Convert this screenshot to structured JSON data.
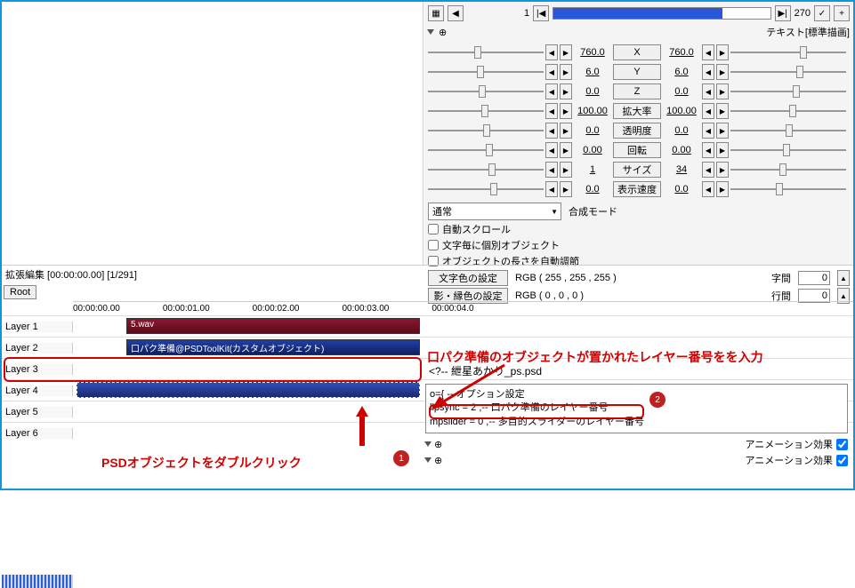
{
  "toolbar": {
    "frame": "1",
    "total": "270",
    "title": "テキスト[標準描画]"
  },
  "params": [
    {
      "name": "X",
      "v1": "760.0",
      "v2": "760.0"
    },
    {
      "name": "Y",
      "v1": "6.0",
      "v2": "6.0"
    },
    {
      "name": "Z",
      "v1": "0.0",
      "v2": "0.0"
    },
    {
      "name": "拡大率",
      "v1": "100.00",
      "v2": "100.00"
    },
    {
      "name": "透明度",
      "v1": "0.0",
      "v2": "0.0"
    },
    {
      "name": "回転",
      "v1": "0.00",
      "v2": "0.00"
    },
    {
      "name": "サイズ",
      "v1": "1",
      "v2": "34"
    },
    {
      "name": "表示速度",
      "v1": "0.0",
      "v2": "0.0"
    }
  ],
  "blend": {
    "label": "合成モード",
    "value": "通常"
  },
  "checks": {
    "autoscroll": "自動スクロール",
    "perchar": "文字毎に個別オブジェクト",
    "autolen": "オブジェクトの長さを自動調節"
  },
  "colors": {
    "text": {
      "label": "文字色の設定",
      "value": "RGB ( 255 , 255 , 255 )"
    },
    "shadow": {
      "label": "影・縁色の設定",
      "value": "RGB ( 0 , 0 , 0 )"
    },
    "spacing": {
      "label": "字間",
      "value": "0"
    },
    "line": {
      "label": "行間",
      "value": "0"
    }
  },
  "timeline": {
    "title": "拡張編集 [00:00:00.00] [1/291]",
    "root": "Root",
    "times": [
      "00:00:00.00",
      "00:00:01.00",
      "00:00:02.00",
      "00:00:03.00",
      "00:00:04.0"
    ],
    "layers": [
      "Layer 1",
      "Layer 2",
      "Layer 3",
      "Layer 4",
      "Layer 5",
      "Layer 6"
    ]
  },
  "clips": {
    "wav": "5.wav",
    "custom": "口パク準備@PSDToolKit(カスタムオブジェクト)",
    "psd": "<?-- 紲星あかり_ps.psd o={ -- オプション設定lipsync = 2"
  },
  "script": {
    "file": "<?-- 紲星あかり_ps.psd",
    "l1": "o={ -- オプション設定",
    "l2": "lipsync = 2    ,-- 口パク準備のレイヤー番号",
    "l3": "mpslider = 0   ,-- 多目的スライダーのレイヤー番号"
  },
  "annot": {
    "a1": "口パク準備のオブジェクトが置かれたレイヤー番号をを入力",
    "a2": "PSDオブジェクトをダブルクリック"
  },
  "anim": "アニメーション効果"
}
